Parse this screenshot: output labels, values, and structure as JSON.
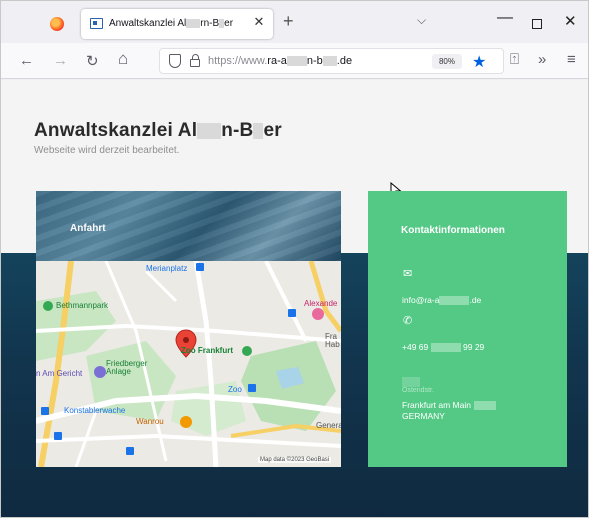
{
  "browser": {
    "tab_title_a": "Anwaltskanzlei Al",
    "tab_title_b": "rn-B",
    "tab_title_c": "er",
    "tab_close": "✕",
    "new_tab": "+",
    "list_all_tabs": "⌵",
    "minimize": "—",
    "close_window": "✕"
  },
  "nav": {
    "back": "←",
    "forward": "→",
    "reload": "↻",
    "home": "⌂",
    "url_prefix": "https://www.",
    "url_a": "ra-a",
    "url_b": "n-b",
    "url_c": ".de",
    "zoom": "80%",
    "bookmark_star": "★",
    "extensions": "⍐",
    "overflow": "»",
    "menu": "≡"
  },
  "site": {
    "title_a": "Anwaltskanzlei Al",
    "title_b": "n-B",
    "title_c": "er",
    "subtitle": "Webseite wird derzeit bearbeitet."
  },
  "anfahrt": {
    "title": "Anfahrt",
    "map_labels": {
      "merianplatz": "Merianplatz",
      "bethmannpark": "Bethmannpark",
      "alexander": "Alexande",
      "friedberger_anlage": "Friedberger Anlage",
      "zoo_frankfurt": "Zoo Frankfurt",
      "am_gericht": "n Am Gericht",
      "zoo": "Zoo",
      "konstablerwache": "Konstablerwache",
      "wanrou": "Wanrou",
      "general": "Genera",
      "fra": "Fra Hab",
      "footer": "Map data ©2023 GeoBasi"
    }
  },
  "kontakt": {
    "title": "Kontaktinformationen",
    "email_icon": "✉",
    "email_a": "info@ra-a",
    "email_b": ".de",
    "phone_icon": "✆",
    "phone_a": "+49 69",
    "phone_b": "99 29",
    "address_small": "Ostendstr.",
    "address_city": "Frankfurt am Main",
    "address_country": "GERMANY"
  },
  "colors": {
    "accent_green": "#54c985",
    "page_dark": "#14435c",
    "bookmark_blue": "#0061e0"
  }
}
